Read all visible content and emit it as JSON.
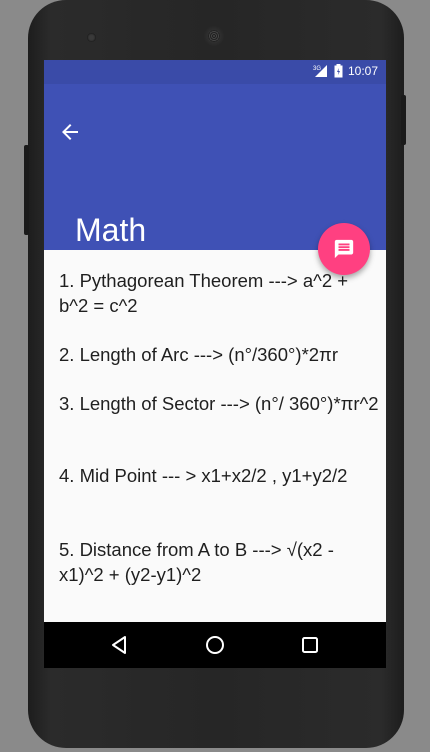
{
  "status_bar": {
    "network": "3G",
    "time": "10:07",
    "icons": [
      "signal-icon",
      "battery-icon"
    ]
  },
  "app_bar": {
    "title": "Math",
    "back_icon": "arrow-left-icon",
    "color": "#3f51b5"
  },
  "formulas": [
    "1. Pythagorean Theorem ---> a^2 + b^2 = c^2",
    "2. Length of Arc ---> (n°/360°)*2πr",
    "3. Length of Sector ---> (n°/ 360°)*πr^2",
    "4. Mid Point --- > x1+x2/2 , y1+y2/2",
    "5. Distance from A to B ---> √(x2 - x1)^2 + (y2-y1)^2"
  ],
  "fab": {
    "icon": "message-icon",
    "color": "#ff4081"
  },
  "nav_bar": {
    "buttons": [
      "back-triangle-icon",
      "home-circle-icon",
      "recents-square-icon"
    ]
  }
}
